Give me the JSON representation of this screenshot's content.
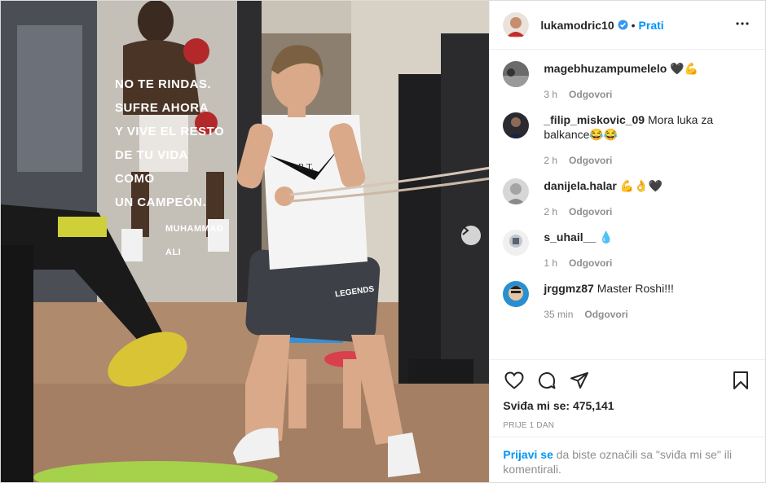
{
  "header": {
    "username": "lukamodric10",
    "separator": "•",
    "follow_label": "Prati"
  },
  "photo": {
    "poster_lines": [
      "NO TE RINDAS.",
      "SUFRE AHORA",
      "Y VIVE EL RESTO",
      "DE TU VIDA COMO",
      "UN CAMPEÓN."
    ],
    "poster_author": "MUHAMMAD ALI",
    "shirt_text": "R.T.",
    "shorts_text": "LEGENDS"
  },
  "comments": [
    {
      "user": "magebhuzampumelelo",
      "text": "🖤💪",
      "time": "3 h",
      "reply": "Odgovori"
    },
    {
      "user": "_filip_miskovic_09",
      "text": "Mora luka za balkance😂😂",
      "time": "2 h",
      "reply": "Odgovori"
    },
    {
      "user": "danijela.halar",
      "text": "💪👌🖤",
      "time": "2 h",
      "reply": "Odgovori"
    },
    {
      "user": "s_uhail__",
      "text": "💧",
      "time": "1 h",
      "reply": "Odgovori"
    },
    {
      "user": "jrggmz87",
      "text": "Master Roshi!!!",
      "time": "35 min",
      "reply": "Odgovori"
    }
  ],
  "likes": {
    "label": "Sviđa mi se:",
    "count": "475,141"
  },
  "date": "PRIJE 1 DAN",
  "login": {
    "link": "Prijavi se",
    "text": "da biste označili sa \"sviđa mi se\" ili komentirali."
  },
  "colors": {
    "accent": "#0095f6",
    "text": "#262626",
    "muted": "#8e8e8e",
    "border": "#efefef"
  },
  "icons": [
    "verified-badge-icon",
    "more-options-icon",
    "heart-icon",
    "comment-icon",
    "share-icon",
    "bookmark-icon",
    "chevron-right-icon"
  ]
}
